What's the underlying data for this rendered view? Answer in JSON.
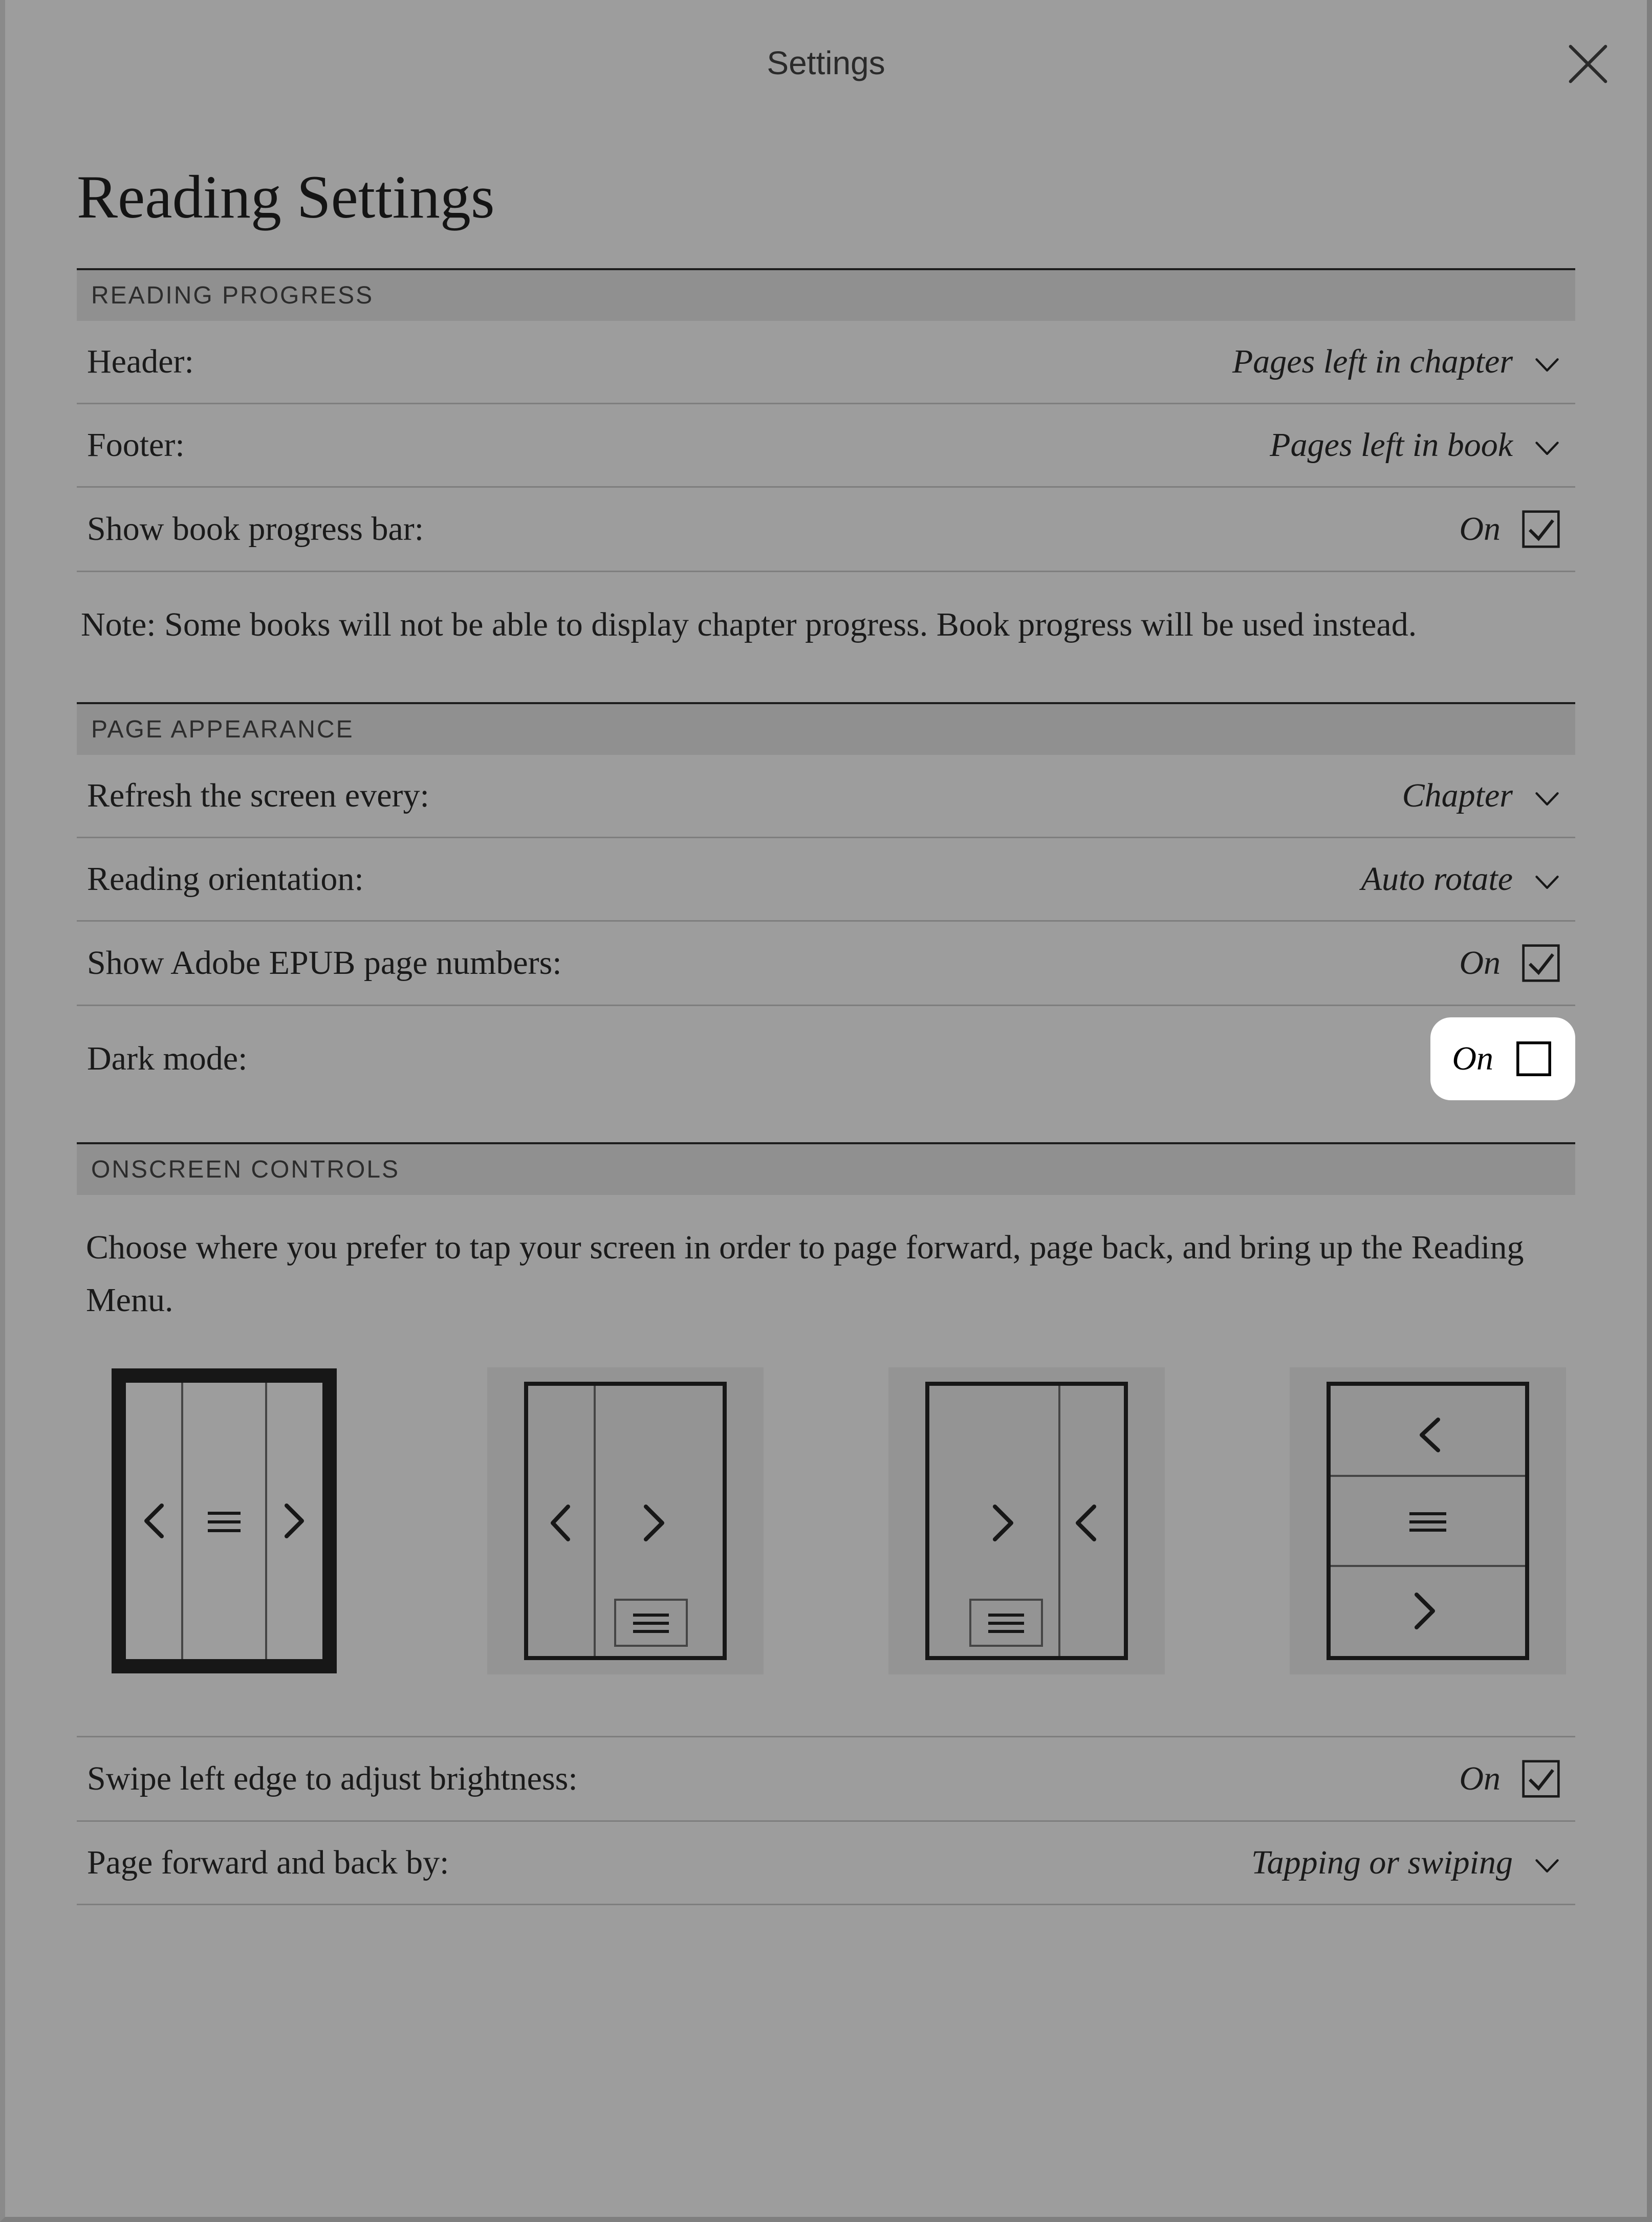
{
  "modal": {
    "title": "Settings"
  },
  "page": {
    "title": "Reading Settings"
  },
  "sections": {
    "reading_progress": {
      "header": "READING PROGRESS",
      "header_label": "Header:",
      "header_value": "Pages left in chapter",
      "footer_label": "Footer:",
      "footer_value": "Pages left in book",
      "progress_bar_label": "Show book progress bar:",
      "progress_bar_value": "On",
      "note": "Note: Some books will not be able to display chapter progress. Book progress will be used instead."
    },
    "page_appearance": {
      "header": "PAGE APPEARANCE",
      "refresh_label": "Refresh the screen every:",
      "refresh_value": "Chapter",
      "orientation_label": "Reading orientation:",
      "orientation_value": "Auto rotate",
      "epub_label": "Show Adobe EPUB page numbers:",
      "epub_value": "On",
      "dark_label": "Dark mode:",
      "dark_value": "On"
    },
    "onscreen": {
      "header": "ONSCREEN CONTROLS",
      "note": "Choose where you prefer to tap your screen in order to page forward, page back, and bring up the Reading Menu.",
      "swipe_label": "Swipe left edge to adjust brightness:",
      "swipe_value": "On",
      "pagefwd_label": "Page forward and back by:",
      "pagefwd_value": "Tapping or swiping"
    }
  }
}
